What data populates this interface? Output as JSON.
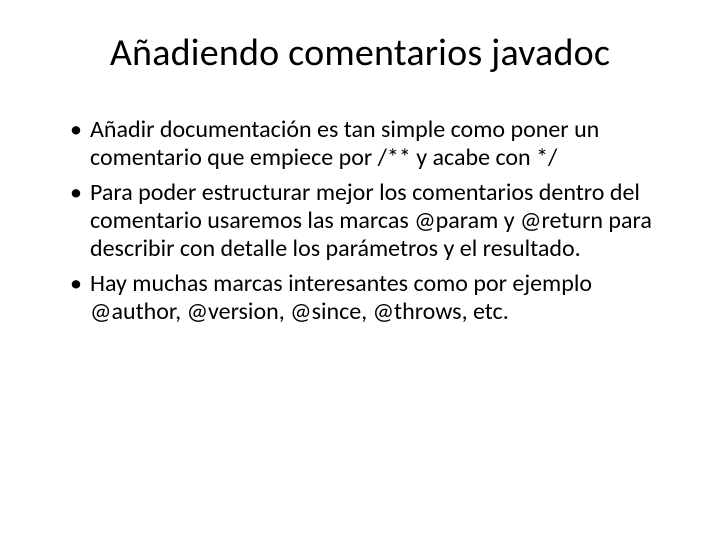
{
  "slide": {
    "title": "Añadiendo comentarios javadoc",
    "bullets": [
      "Añadir documentación es tan simple como poner un comentario que empiece por /** y acabe con */",
      "Para poder estructurar mejor los comentarios dentro del comentario usaremos las marcas @param y @return para describir con detalle los parámetros y el resultado.",
      "Hay muchas marcas interesantes como por ejemplo @author, @version, @since, @throws, etc."
    ]
  }
}
